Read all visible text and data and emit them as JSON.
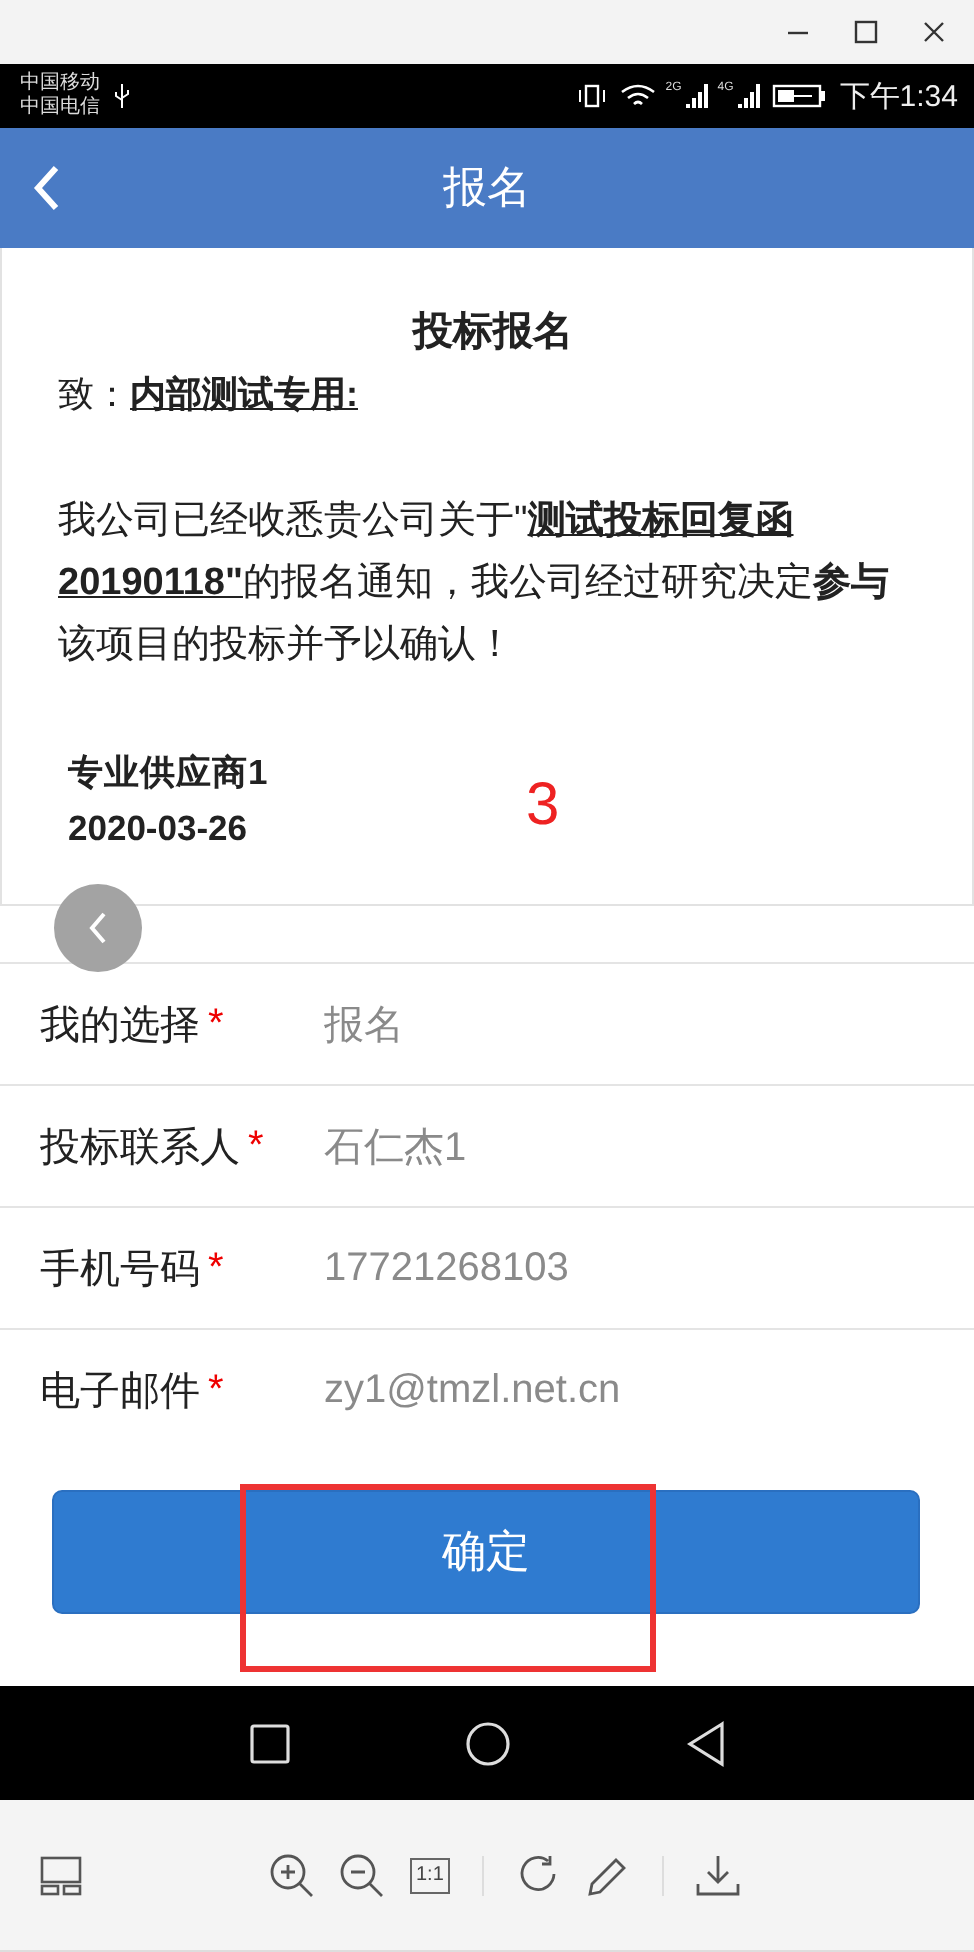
{
  "status_bar": {
    "carriers": [
      "中国移动",
      "中国电信"
    ],
    "network_labels": [
      "2G",
      "4G"
    ],
    "time": "下午1:34"
  },
  "app_bar": {
    "title": "报名"
  },
  "notice": {
    "title": "投标报名",
    "salutation": "致：**内部测试专用:**",
    "body": "我公司已经收悉贵公司关于\"**测试投标回复函20190118\"**的报名通知，我公司经过研究决定**参与**该项目的投标并予以确认！",
    "signer": "专业供应商1",
    "date": "2020-03-26"
  },
  "annotation": {
    "text": "3"
  },
  "form": {
    "fields": [
      {
        "label": "我的选择",
        "required_mark": "*",
        "value": "报名"
      },
      {
        "label": "投标联系人",
        "required_mark": "*",
        "value": "石仁杰1"
      },
      {
        "label": "手机号码",
        "required_mark": "*",
        "value": "17721268103"
      },
      {
        "label": "电子邮件",
        "required_mark": "*",
        "value": "zy1@tmzl.net.cn"
      }
    ]
  },
  "submit_button": {
    "label": "确定"
  },
  "toolbar": {
    "actual_size_label": "1:1"
  }
}
